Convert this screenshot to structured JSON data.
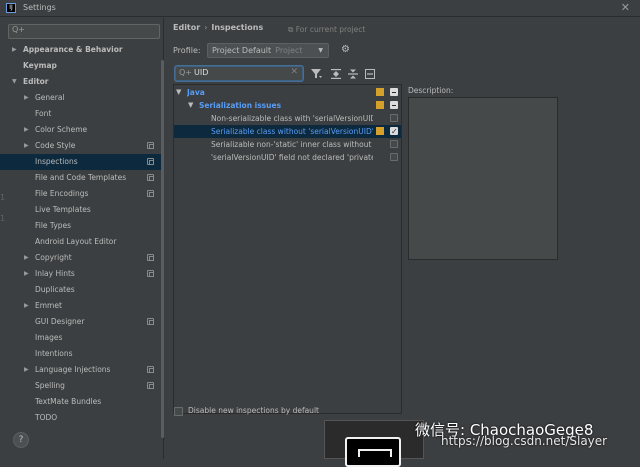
{
  "window": {
    "title": "Settings",
    "close_glyph": "✕"
  },
  "search": {
    "placeholder": "Q+"
  },
  "sidebar": {
    "items": [
      {
        "label": "Appearance & Behavior",
        "arrow": "▶",
        "bold": true,
        "indent": 0,
        "has_icon": false,
        "selected": false
      },
      {
        "label": "Keymap",
        "arrow": "",
        "bold": true,
        "indent": 0,
        "has_icon": false,
        "selected": false
      },
      {
        "label": "Editor",
        "arrow": "▼",
        "bold": true,
        "indent": 0,
        "has_icon": false,
        "selected": false
      },
      {
        "label": "General",
        "arrow": "▶",
        "bold": false,
        "indent": 1,
        "has_icon": false,
        "selected": false
      },
      {
        "label": "Font",
        "arrow": "",
        "bold": false,
        "indent": 1,
        "has_icon": false,
        "selected": false
      },
      {
        "label": "Color Scheme",
        "arrow": "▶",
        "bold": false,
        "indent": 1,
        "has_icon": false,
        "selected": false
      },
      {
        "label": "Code Style",
        "arrow": "▶",
        "bold": false,
        "indent": 1,
        "has_icon": true,
        "selected": false
      },
      {
        "label": "Inspections",
        "arrow": "",
        "bold": false,
        "indent": 1,
        "has_icon": true,
        "selected": true
      },
      {
        "label": "File and Code Templates",
        "arrow": "",
        "bold": false,
        "indent": 1,
        "has_icon": true,
        "selected": false
      },
      {
        "label": "File Encodings",
        "arrow": "",
        "bold": false,
        "indent": 1,
        "has_icon": true,
        "selected": false
      },
      {
        "label": "Live Templates",
        "arrow": "",
        "bold": false,
        "indent": 1,
        "has_icon": false,
        "selected": false
      },
      {
        "label": "File Types",
        "arrow": "",
        "bold": false,
        "indent": 1,
        "has_icon": false,
        "selected": false
      },
      {
        "label": "Android Layout Editor",
        "arrow": "",
        "bold": false,
        "indent": 1,
        "has_icon": false,
        "selected": false
      },
      {
        "label": "Copyright",
        "arrow": "▶",
        "bold": false,
        "indent": 1,
        "has_icon": true,
        "selected": false
      },
      {
        "label": "Inlay Hints",
        "arrow": "▶",
        "bold": false,
        "indent": 1,
        "has_icon": true,
        "selected": false
      },
      {
        "label": "Duplicates",
        "arrow": "",
        "bold": false,
        "indent": 1,
        "has_icon": false,
        "selected": false
      },
      {
        "label": "Emmet",
        "arrow": "▶",
        "bold": false,
        "indent": 1,
        "has_icon": false,
        "selected": false
      },
      {
        "label": "GUI Designer",
        "arrow": "",
        "bold": false,
        "indent": 1,
        "has_icon": true,
        "selected": false
      },
      {
        "label": "Images",
        "arrow": "",
        "bold": false,
        "indent": 1,
        "has_icon": false,
        "selected": false
      },
      {
        "label": "Intentions",
        "arrow": "",
        "bold": false,
        "indent": 1,
        "has_icon": false,
        "selected": false
      },
      {
        "label": "Language Injections",
        "arrow": "▶",
        "bold": false,
        "indent": 1,
        "has_icon": true,
        "selected": false
      },
      {
        "label": "Spelling",
        "arrow": "",
        "bold": false,
        "indent": 1,
        "has_icon": true,
        "selected": false
      },
      {
        "label": "TextMate Bundles",
        "arrow": "",
        "bold": false,
        "indent": 1,
        "has_icon": false,
        "selected": false
      },
      {
        "label": "TODO",
        "arrow": "",
        "bold": false,
        "indent": 1,
        "has_icon": false,
        "selected": false
      }
    ]
  },
  "gutter": {
    "marks": "1\n1"
  },
  "help": {
    "label": "?"
  },
  "header": {
    "crumb1": "Editor",
    "crumb_sep": "›",
    "crumb2": "Inspections",
    "for_project": "⧉ For current project"
  },
  "profile": {
    "label": "Profile:",
    "value": "Project Default",
    "sub": "Project",
    "dropdown": "▼"
  },
  "filter": {
    "value": "UID",
    "clear_glyph": "✕",
    "search_glyph": "Q+"
  },
  "toolbar": {
    "filter_icon": "filter-icon",
    "expand_icon": "expand-all-icon",
    "collapse_icon": "collapse-all-icon",
    "reset_icon": "reset-icon"
  },
  "inspections": {
    "rows": [
      {
        "label": "Java",
        "arrow": "▼",
        "level": 0,
        "style": "group",
        "severity": true,
        "check": "part",
        "selected": false
      },
      {
        "label": "Serialization issues",
        "arrow": "▼",
        "level": 1,
        "style": "group",
        "severity": true,
        "check": "part",
        "selected": false
      },
      {
        "label": "Non-serializable class with 'serialVersionUID'",
        "arrow": "",
        "level": 2,
        "style": "normal",
        "severity": false,
        "check": "off",
        "selected": false
      },
      {
        "label": "Serializable class without 'serialVersionUID'",
        "arrow": "",
        "level": 2,
        "style": "selected",
        "severity": true,
        "check": "on",
        "selected": true
      },
      {
        "label": "Serializable non-'static' inner class without 'serialVersionUID'",
        "arrow": "",
        "level": 2,
        "style": "normal",
        "severity": false,
        "check": "off",
        "selected": false
      },
      {
        "label": "'serialVersionUID' field not declared 'private static final long'",
        "arrow": "",
        "level": 2,
        "style": "normal",
        "severity": false,
        "check": "off",
        "selected": false
      }
    ]
  },
  "description": {
    "label": "Description:"
  },
  "disable_new": {
    "label": "Disable new inspections by default"
  },
  "watermark": {
    "wechat": "微信号: ChaochaoGege8",
    "blog": "https://blog.csdn.net/Slayer"
  },
  "colors": {
    "selection": "#0d293e",
    "accent": "#589df6",
    "severity": "#d6a12b",
    "background": "#3c3f41"
  }
}
